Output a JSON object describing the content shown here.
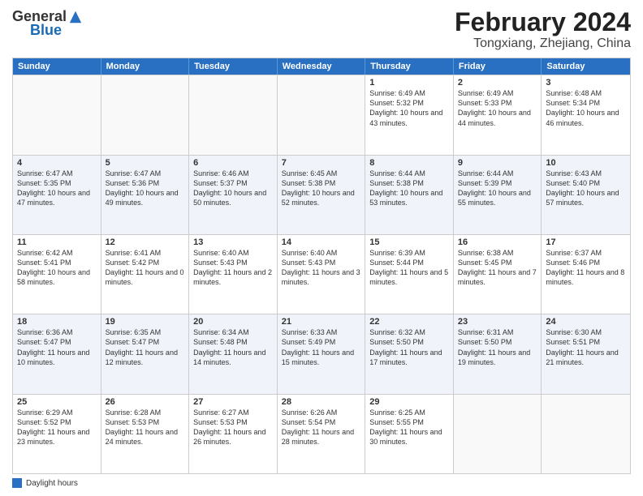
{
  "header": {
    "logo_general": "General",
    "logo_blue": "Blue",
    "month_title": "February 2024",
    "location": "Tongxiang, Zhejiang, China"
  },
  "days_of_week": [
    "Sunday",
    "Monday",
    "Tuesday",
    "Wednesday",
    "Thursday",
    "Friday",
    "Saturday"
  ],
  "weeks": [
    [
      {
        "date": "",
        "info": ""
      },
      {
        "date": "",
        "info": ""
      },
      {
        "date": "",
        "info": ""
      },
      {
        "date": "",
        "info": ""
      },
      {
        "date": "1",
        "info": "Sunrise: 6:49 AM\nSunset: 5:32 PM\nDaylight: 10 hours and 43 minutes."
      },
      {
        "date": "2",
        "info": "Sunrise: 6:49 AM\nSunset: 5:33 PM\nDaylight: 10 hours and 44 minutes."
      },
      {
        "date": "3",
        "info": "Sunrise: 6:48 AM\nSunset: 5:34 PM\nDaylight: 10 hours and 46 minutes."
      }
    ],
    [
      {
        "date": "4",
        "info": "Sunrise: 6:47 AM\nSunset: 5:35 PM\nDaylight: 10 hours and 47 minutes."
      },
      {
        "date": "5",
        "info": "Sunrise: 6:47 AM\nSunset: 5:36 PM\nDaylight: 10 hours and 49 minutes."
      },
      {
        "date": "6",
        "info": "Sunrise: 6:46 AM\nSunset: 5:37 PM\nDaylight: 10 hours and 50 minutes."
      },
      {
        "date": "7",
        "info": "Sunrise: 6:45 AM\nSunset: 5:38 PM\nDaylight: 10 hours and 52 minutes."
      },
      {
        "date": "8",
        "info": "Sunrise: 6:44 AM\nSunset: 5:38 PM\nDaylight: 10 hours and 53 minutes."
      },
      {
        "date": "9",
        "info": "Sunrise: 6:44 AM\nSunset: 5:39 PM\nDaylight: 10 hours and 55 minutes."
      },
      {
        "date": "10",
        "info": "Sunrise: 6:43 AM\nSunset: 5:40 PM\nDaylight: 10 hours and 57 minutes."
      }
    ],
    [
      {
        "date": "11",
        "info": "Sunrise: 6:42 AM\nSunset: 5:41 PM\nDaylight: 10 hours and 58 minutes."
      },
      {
        "date": "12",
        "info": "Sunrise: 6:41 AM\nSunset: 5:42 PM\nDaylight: 11 hours and 0 minutes."
      },
      {
        "date": "13",
        "info": "Sunrise: 6:40 AM\nSunset: 5:43 PM\nDaylight: 11 hours and 2 minutes."
      },
      {
        "date": "14",
        "info": "Sunrise: 6:40 AM\nSunset: 5:43 PM\nDaylight: 11 hours and 3 minutes."
      },
      {
        "date": "15",
        "info": "Sunrise: 6:39 AM\nSunset: 5:44 PM\nDaylight: 11 hours and 5 minutes."
      },
      {
        "date": "16",
        "info": "Sunrise: 6:38 AM\nSunset: 5:45 PM\nDaylight: 11 hours and 7 minutes."
      },
      {
        "date": "17",
        "info": "Sunrise: 6:37 AM\nSunset: 5:46 PM\nDaylight: 11 hours and 8 minutes."
      }
    ],
    [
      {
        "date": "18",
        "info": "Sunrise: 6:36 AM\nSunset: 5:47 PM\nDaylight: 11 hours and 10 minutes."
      },
      {
        "date": "19",
        "info": "Sunrise: 6:35 AM\nSunset: 5:47 PM\nDaylight: 11 hours and 12 minutes."
      },
      {
        "date": "20",
        "info": "Sunrise: 6:34 AM\nSunset: 5:48 PM\nDaylight: 11 hours and 14 minutes."
      },
      {
        "date": "21",
        "info": "Sunrise: 6:33 AM\nSunset: 5:49 PM\nDaylight: 11 hours and 15 minutes."
      },
      {
        "date": "22",
        "info": "Sunrise: 6:32 AM\nSunset: 5:50 PM\nDaylight: 11 hours and 17 minutes."
      },
      {
        "date": "23",
        "info": "Sunrise: 6:31 AM\nSunset: 5:50 PM\nDaylight: 11 hours and 19 minutes."
      },
      {
        "date": "24",
        "info": "Sunrise: 6:30 AM\nSunset: 5:51 PM\nDaylight: 11 hours and 21 minutes."
      }
    ],
    [
      {
        "date": "25",
        "info": "Sunrise: 6:29 AM\nSunset: 5:52 PM\nDaylight: 11 hours and 23 minutes."
      },
      {
        "date": "26",
        "info": "Sunrise: 6:28 AM\nSunset: 5:53 PM\nDaylight: 11 hours and 24 minutes."
      },
      {
        "date": "27",
        "info": "Sunrise: 6:27 AM\nSunset: 5:53 PM\nDaylight: 11 hours and 26 minutes."
      },
      {
        "date": "28",
        "info": "Sunrise: 6:26 AM\nSunset: 5:54 PM\nDaylight: 11 hours and 28 minutes."
      },
      {
        "date": "29",
        "info": "Sunrise: 6:25 AM\nSunset: 5:55 PM\nDaylight: 11 hours and 30 minutes."
      },
      {
        "date": "",
        "info": ""
      },
      {
        "date": "",
        "info": ""
      }
    ]
  ],
  "legend": {
    "label": "Daylight hours"
  },
  "alt_rows": [
    1,
    3
  ]
}
